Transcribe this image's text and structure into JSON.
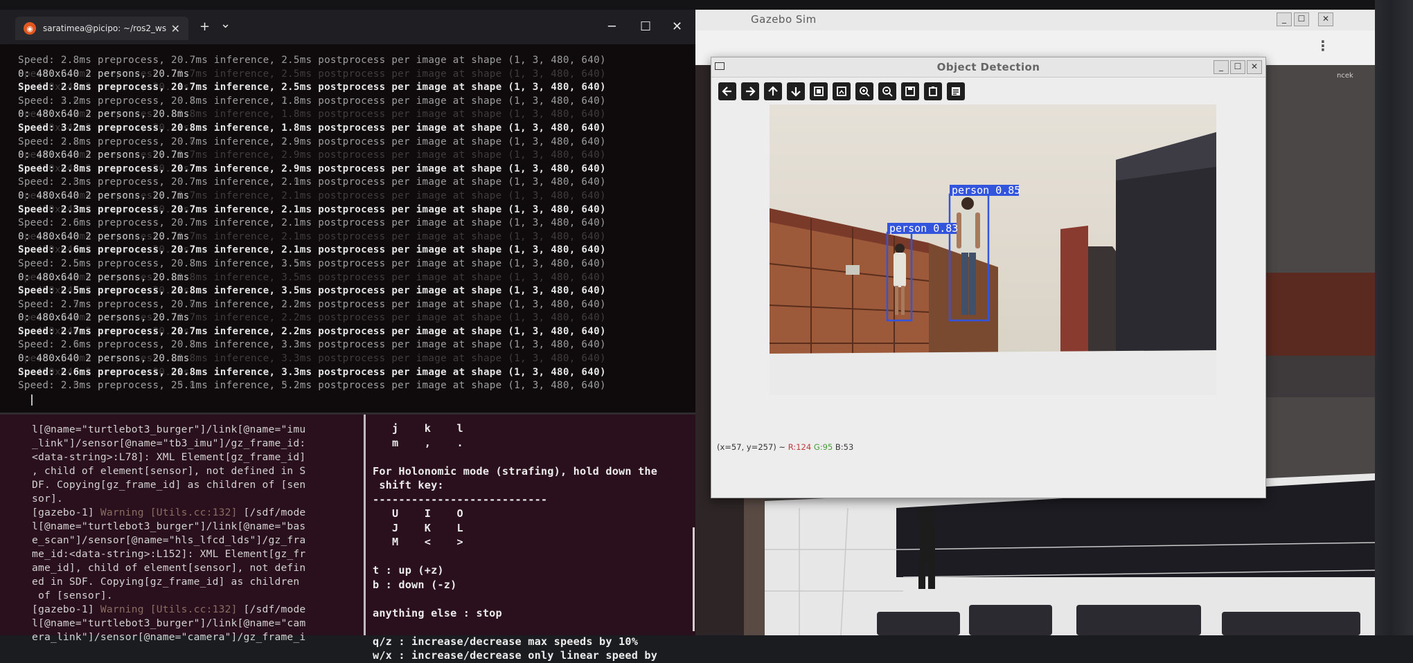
{
  "terminal": {
    "tab_title": "saratimea@picipo: ~/ros2_ws",
    "close_tab_glyph": "✕",
    "new_tab_glyph": "+",
    "dropdown_glyph": "⌄",
    "minimize_glyph": "─",
    "maximize_glyph": "☐",
    "close_glyph": "✕",
    "upper_lines": [
      {
        "text": "Speed: 2.8ms preprocess, 20.7ms inference, 2.5ms postprocess per image at shape (1, 3, 480, 640)",
        "style": "d"
      },
      {
        "text": "0: 480x640 2 persons, 20.7ms",
        "style": "n"
      },
      {
        "text": "Speed: 2.8ms preprocess, 20.7ms inference, 2.5ms postprocess per image at shape (1, 3, 480, 640)",
        "style": "b"
      },
      {
        "text": "Speed: 3.2ms preprocess, 20.8ms inference, 1.8ms postprocess per image at shape (1, 3, 480, 640)",
        "style": "d"
      },
      {
        "text": "0: 480x640 2 persons, 20.8ms",
        "style": "n"
      },
      {
        "text": "Speed: 3.2ms preprocess, 20.8ms inference, 1.8ms postprocess per image at shape (1, 3, 480, 640)",
        "style": "b"
      },
      {
        "text": "Speed: 2.8ms preprocess, 20.7ms inference, 2.9ms postprocess per image at shape (1, 3, 480, 640)",
        "style": "d"
      },
      {
        "text": "0: 480x640 2 persons, 20.7ms",
        "style": "n"
      },
      {
        "text": "Speed: 2.8ms preprocess, 20.7ms inference, 2.9ms postprocess per image at shape (1, 3, 480, 640)",
        "style": "b"
      },
      {
        "text": "Speed: 2.3ms preprocess, 20.7ms inference, 2.1ms postprocess per image at shape (1, 3, 480, 640)",
        "style": "d"
      },
      {
        "text": "0: 480x640 2 persons, 20.7ms",
        "style": "n"
      },
      {
        "text": "Speed: 2.3ms preprocess, 20.7ms inference, 2.1ms postprocess per image at shape (1, 3, 480, 640)",
        "style": "b"
      },
      {
        "text": "Speed: 2.6ms preprocess, 20.7ms inference, 2.1ms postprocess per image at shape (1, 3, 480, 640)",
        "style": "d"
      },
      {
        "text": "0: 480x640 2 persons, 20.7ms",
        "style": "n"
      },
      {
        "text": "Speed: 2.6ms preprocess, 20.7ms inference, 2.1ms postprocess per image at shape (1, 3, 480, 640)",
        "style": "b"
      },
      {
        "text": "Speed: 2.5ms preprocess, 20.8ms inference, 3.5ms postprocess per image at shape (1, 3, 480, 640)",
        "style": "d"
      },
      {
        "text": "0: 480x640 2 persons, 20.8ms",
        "style": "n"
      },
      {
        "text": "Speed: 2.5ms preprocess, 20.8ms inference, 3.5ms postprocess per image at shape (1, 3, 480, 640)",
        "style": "b"
      },
      {
        "text": "Speed: 2.7ms preprocess, 20.7ms inference, 2.2ms postprocess per image at shape (1, 3, 480, 640)",
        "style": "d"
      },
      {
        "text": "0: 480x640 2 persons, 20.7ms",
        "style": "n"
      },
      {
        "text": "Speed: 2.7ms preprocess, 20.7ms inference, 2.2ms postprocess per image at shape (1, 3, 480, 640)",
        "style": "b"
      },
      {
        "text": "Speed: 2.6ms preprocess, 20.8ms inference, 3.3ms postprocess per image at shape (1, 3, 480, 640)",
        "style": "d"
      },
      {
        "text": "0: 480x640 2 persons, 20.8ms",
        "style": "n"
      },
      {
        "text": "Speed: 2.6ms preprocess, 20.8ms inference, 3.3ms postprocess per image at shape (1, 3, 480, 640)",
        "style": "b"
      },
      {
        "text": "Speed: 2.3ms preprocess, 25.1ms inference, 5.2ms postprocess per image at shape (1, 3, 480, 640)",
        "style": "d"
      }
    ],
    "lower_left_lines": [
      {
        "pre": "l[@name=\"turtlebot3_burger\"]/link[@name=\"imu",
        "warn": "",
        "post": ""
      },
      {
        "pre": "_link\"]/sensor[@name=\"tb3_imu\"]/gz_frame_id:",
        "warn": "",
        "post": ""
      },
      {
        "pre": "<data-string>:L78]: XML Element[gz_frame_id]",
        "warn": "",
        "post": ""
      },
      {
        "pre": ", child of element[sensor], not defined in S",
        "warn": "",
        "post": ""
      },
      {
        "pre": "DF. Copying[gz_frame_id] as children of [sen",
        "warn": "",
        "post": ""
      },
      {
        "pre": "sor].",
        "warn": "",
        "post": ""
      },
      {
        "pre": "[gazebo-1] ",
        "warn": "Warning [Utils.cc:132]",
        "post": " [/sdf/mode"
      },
      {
        "pre": "l[@name=\"turtlebot3_burger\"]/link[@name=\"bas",
        "warn": "",
        "post": ""
      },
      {
        "pre": "e_scan\"]/sensor[@name=\"hls_lfcd_lds\"]/gz_fra",
        "warn": "",
        "post": ""
      },
      {
        "pre": "me_id:<data-string>:L152]: XML Element[gz_fr",
        "warn": "",
        "post": ""
      },
      {
        "pre": "ame_id], child of element[sensor], not defin",
        "warn": "",
        "post": ""
      },
      {
        "pre": "ed in SDF. Copying[gz_frame_id] as children",
        "warn": "",
        "post": ""
      },
      {
        "pre": " of [sensor].",
        "warn": "",
        "post": ""
      },
      {
        "pre": "[gazebo-1] ",
        "warn": "Warning [Utils.cc:132]",
        "post": " [/sdf/mode"
      },
      {
        "pre": "l[@name=\"turtlebot3_burger\"]/link[@name=\"cam",
        "warn": "",
        "post": ""
      },
      {
        "pre": "era_link\"]/sensor[@name=\"camera\"]/gz_frame_i",
        "warn": "",
        "post": ""
      }
    ],
    "lower_right_lines": [
      "   j    k    l",
      "   m    ,    .",
      "",
      "For Holonomic mode (strafing), hold down the",
      " shift key:",
      "---------------------------",
      "   U    I    O",
      "   J    K    L",
      "   M    <    >",
      "",
      "t : up (+z)",
      "b : down (-z)",
      "",
      "anything else : stop",
      "",
      "q/z : increase/decrease max speeds by 10%",
      "w/x : increase/decrease only linear speed by"
    ]
  },
  "gazebo": {
    "title": "Gazebo Sim",
    "menu_glyph": "⋮",
    "window_buttons": [
      "_",
      "☐",
      "✕"
    ]
  },
  "object_detection": {
    "title": "Object Detection",
    "window_buttons": [
      "_",
      "☐",
      "✕"
    ],
    "toolbar_icons": [
      "arrow-left-icon",
      "arrow-right-icon",
      "arrow-up-icon",
      "arrow-down-icon",
      "zoom-to-rect-icon",
      "save-region-icon",
      "zoom-in-icon",
      "zoom-out-icon",
      "save-icon",
      "copy-icon",
      "properties-icon"
    ],
    "detections": [
      {
        "label": "person",
        "score": "0.85"
      },
      {
        "label": "person",
        "score": "0.83"
      }
    ],
    "box_color": "#3355dd",
    "status": {
      "coords": "(x=57, y=257) ~",
      "r": "R:124",
      "g": "G:95",
      "b": "B:53"
    }
  },
  "edge": {
    "text": "ncek"
  }
}
